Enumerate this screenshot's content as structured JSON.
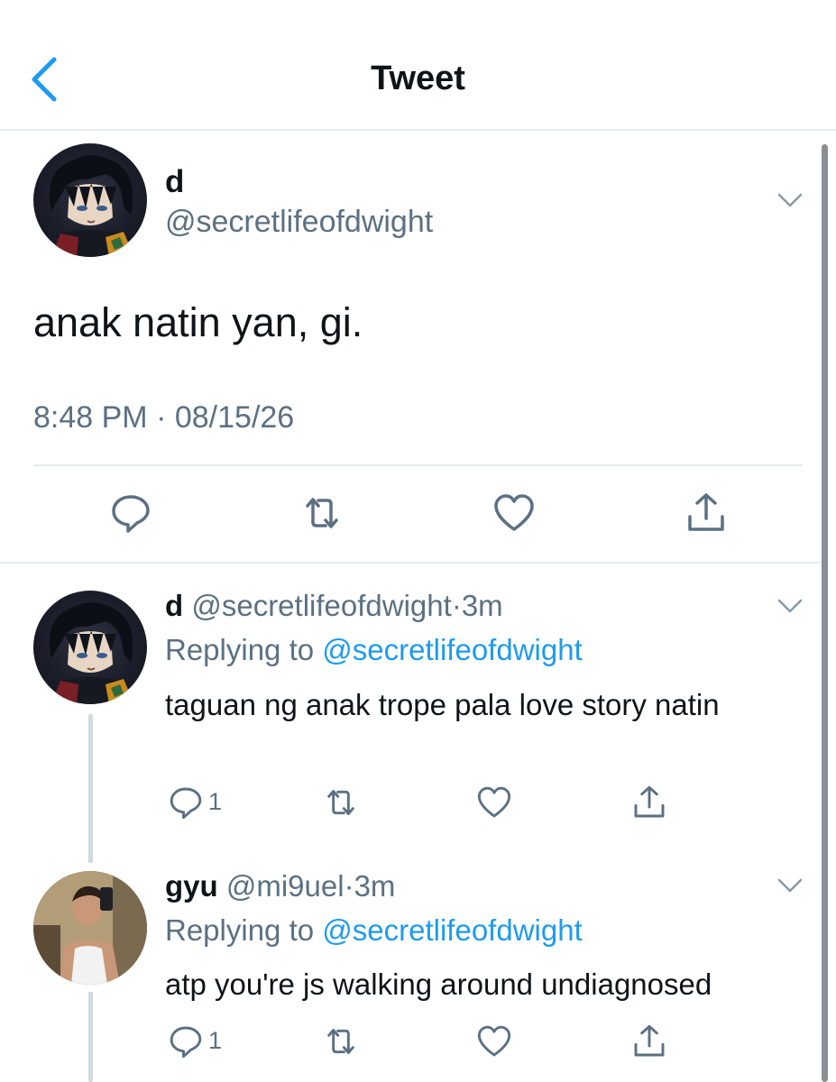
{
  "header": {
    "title": "Tweet"
  },
  "main_tweet": {
    "name": "d",
    "handle": "@secretlifeofdwight",
    "text": "anak natin yan, gi.",
    "time": "8:48 PM",
    "separator": "·",
    "date": "08/15/26"
  },
  "replies": [
    {
      "name": "d",
      "handle": "@secretlifeofdwight",
      "separator": "·",
      "time_ago": "3m",
      "replying_label": "Replying to",
      "replying_to": "@secretlifeofdwight",
      "text": "taguan ng anak trope pala love story natin",
      "reply_count": "1"
    },
    {
      "name": "gyu",
      "handle": "@mi9uel",
      "separator": "·",
      "time_ago": "3m",
      "replying_label": "Replying to",
      "replying_to": "@secretlifeofdwight",
      "text": "atp you're js walking around undiagnosed",
      "reply_count": "1"
    }
  ],
  "icons": {
    "back": "chevron-left-icon",
    "more": "chevron-down-icon",
    "reply": "speech-bubble-icon",
    "retweet": "retweet-icon",
    "like": "heart-icon",
    "share": "share-icon"
  },
  "colors": {
    "accent": "#1d9bf0",
    "secondary_text": "#5b7083",
    "divider": "#e6ecf0",
    "text": "#0f1419"
  }
}
